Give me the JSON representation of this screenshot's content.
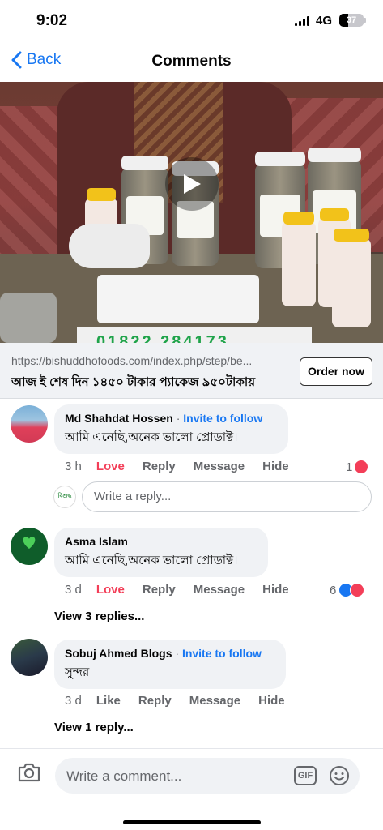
{
  "status_bar": {
    "time": "9:02",
    "network": "4G",
    "battery": "37",
    "battery_level": 0.37
  },
  "nav": {
    "back_label": "Back",
    "title": "Comments"
  },
  "video": {
    "banner_text": "01822 284173"
  },
  "link_preview": {
    "url": "https://bishuddhofoods.com/index.php/step/be...",
    "title": "আজ ই শেষ দিন ১৪৫০ টাকার প্যাকেজ ৯৫০টাকায়",
    "cta": "Order now"
  },
  "comments": [
    {
      "author": "Md Shahdat Hossen",
      "separator": "·",
      "follow": "Invite to follow",
      "text": "আমি এনেছি,অনেক ভালো প্রোডাক্ট।",
      "age": "3 h",
      "actions": [
        "Love",
        "Reply",
        "Message",
        "Hide"
      ],
      "reaction_count": "1"
    },
    {
      "author": "Asma Islam",
      "text": "আমি এনেছি,অনেক  ভালো প্রোডাক্ট।",
      "age": "3 d",
      "actions": [
        "Love",
        "Reply",
        "Message",
        "Hide"
      ],
      "reaction_count": "6",
      "view_replies": "View 3 replies..."
    },
    {
      "author": "Sobuj Ahmed Blogs",
      "separator": "·",
      "follow": "Invite to follow",
      "text": "সুন্দর",
      "age": "3 d",
      "actions": [
        "Like",
        "Reply",
        "Message",
        "Hide"
      ],
      "view_replies": "View 1 reply..."
    }
  ],
  "reply_box": {
    "placeholder": "Write a reply..."
  },
  "composer": {
    "placeholder": "Write a comment...",
    "gif_label": "GIF"
  },
  "colors": {
    "accent": "#1877f2",
    "love": "#f33e58",
    "bubble": "#f0f2f5",
    "secondary_text": "#65676b"
  },
  "icons": [
    "back-chevron-icon",
    "play-icon",
    "camera-icon",
    "gif-icon",
    "emoji-icon",
    "heart-reaction-icon",
    "like-reaction-icon"
  ]
}
